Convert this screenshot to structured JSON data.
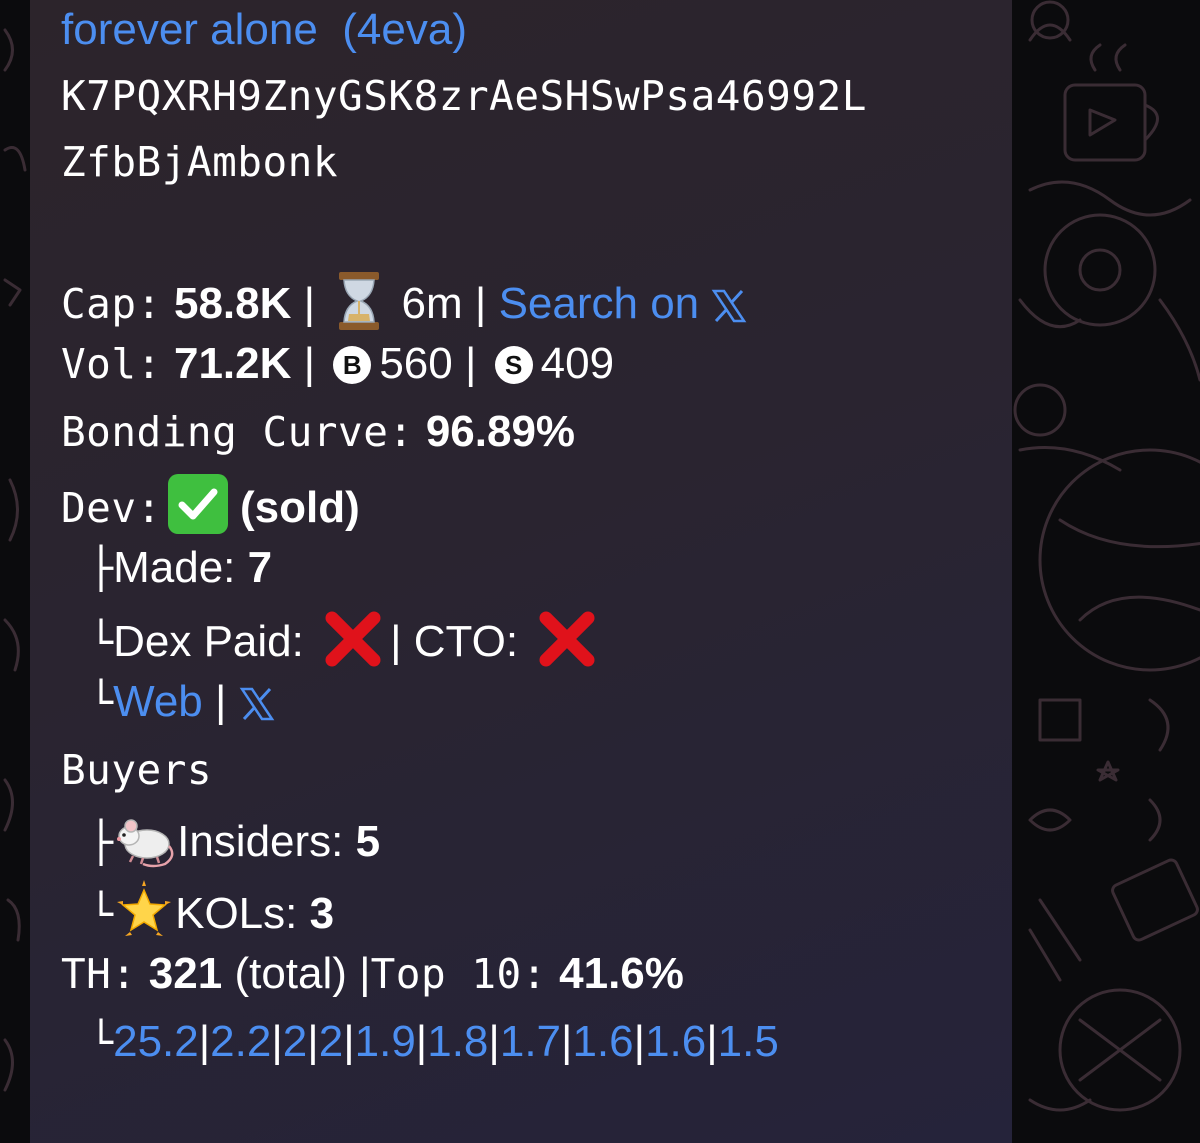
{
  "token": {
    "name": "forever alone",
    "ticker": "(4eva)",
    "address_line1": "K7PQXRH9ZnyGSK8zrAeSHSwPsa46992L",
    "address_line2": "ZfbBjAmbonk"
  },
  "cap": {
    "label": "Cap:",
    "value": "58.8K",
    "age": "6m",
    "search_link": "Search on"
  },
  "vol": {
    "label": "Vol:",
    "value": "71.2K",
    "buy_badge": "B",
    "buys": "560",
    "sell_badge": "S",
    "sells": "409"
  },
  "bonding": {
    "label": "Bonding Curve:",
    "value": "96.89%"
  },
  "dev": {
    "label": "Dev:",
    "status": "(sold)",
    "made_prefix": "├",
    "made_label": "Made:",
    "made_value": "7",
    "dex_prefix": "└",
    "dex_label": "Dex Paid:",
    "cto_label": "| CTO:",
    "links_prefix": "└",
    "web_link": "Web"
  },
  "buyers": {
    "label": "Buyers",
    "insiders_prefix": "├",
    "insiders_label": "Insiders:",
    "insiders_value": "5",
    "kols_prefix": "└",
    "kols_label": "KOLs:",
    "kols_value": "3"
  },
  "holders": {
    "label": "TH:",
    "total": "321",
    "total_label": "(total)",
    "top_label": "Top 10:",
    "top_value": "41.6%",
    "dist_prefix": "└",
    "distribution": [
      "25.2",
      "2.2",
      "2",
      "2",
      "1.9",
      "1.8",
      "1.7",
      "1.6",
      "1.6",
      "1.5"
    ]
  },
  "separator": "|",
  "icons": [
    "hourglass-icon",
    "x-logo-icon",
    "check-mark-icon",
    "cross-mark-icon",
    "rat-icon",
    "glowing-star-icon"
  ],
  "colors": {
    "link": "#4c8ef0",
    "text": "#ffffff",
    "bubble": "#2a2430",
    "check": "#3fbf3f",
    "cross": "#e0121b"
  }
}
